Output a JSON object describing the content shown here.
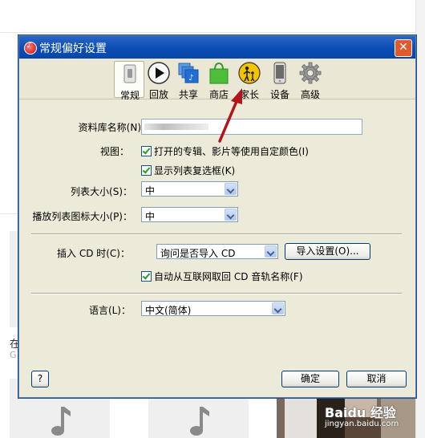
{
  "background": {
    "left_title": "在",
    "left_sub": "G",
    "note_icon": "music-note-icon"
  },
  "dialog": {
    "title": "常规偏好设置",
    "app_icon": "itunes-icon",
    "close_label": "✕",
    "tabs": [
      {
        "label": "常规",
        "icon": "general-switch-icon",
        "active": true
      },
      {
        "label": "回放",
        "icon": "play-icon",
        "active": false
      },
      {
        "label": "共享",
        "icon": "sharing-icon",
        "active": false
      },
      {
        "label": "商店",
        "icon": "store-bag-icon",
        "active": false
      },
      {
        "label": "家长",
        "icon": "parental-icon",
        "active": false
      },
      {
        "label": "设备",
        "icon": "device-icon",
        "active": false
      },
      {
        "label": "高级",
        "icon": "gear-icon",
        "active": false
      }
    ],
    "form": {
      "library_name_label": "资料库名称(N)：",
      "library_name_value": "",
      "view_label": "视图：",
      "view_option1": "打开的专辑、影片等使用自定颜色(I)",
      "view_option2": "显示列表复选框(K)",
      "list_size_label": "列表大小(S)：",
      "list_size_value": "中",
      "playlist_icon_size_label": "播放列表图标大小(P)：",
      "playlist_icon_size_value": "中",
      "insert_cd_label": "插入 CD 时(C)：",
      "insert_cd_value": "询问是否导入 CD",
      "import_settings_button": "导入设置(O)...",
      "auto_cd_names": "自动从互联网取回 CD 音轨名称(F)",
      "language_label": "语言(L)：",
      "language_value": "中文(简体)"
    },
    "buttons": {
      "help": "?",
      "ok": "确定",
      "cancel": "取消"
    }
  },
  "watermark": {
    "brand": "Baidu 经验",
    "url": "jingyan.baidu.com"
  },
  "colors": {
    "titlebar": "#0b4cb3",
    "dialog_bg": "#ebe9d8",
    "arrow": "#b3141a"
  }
}
